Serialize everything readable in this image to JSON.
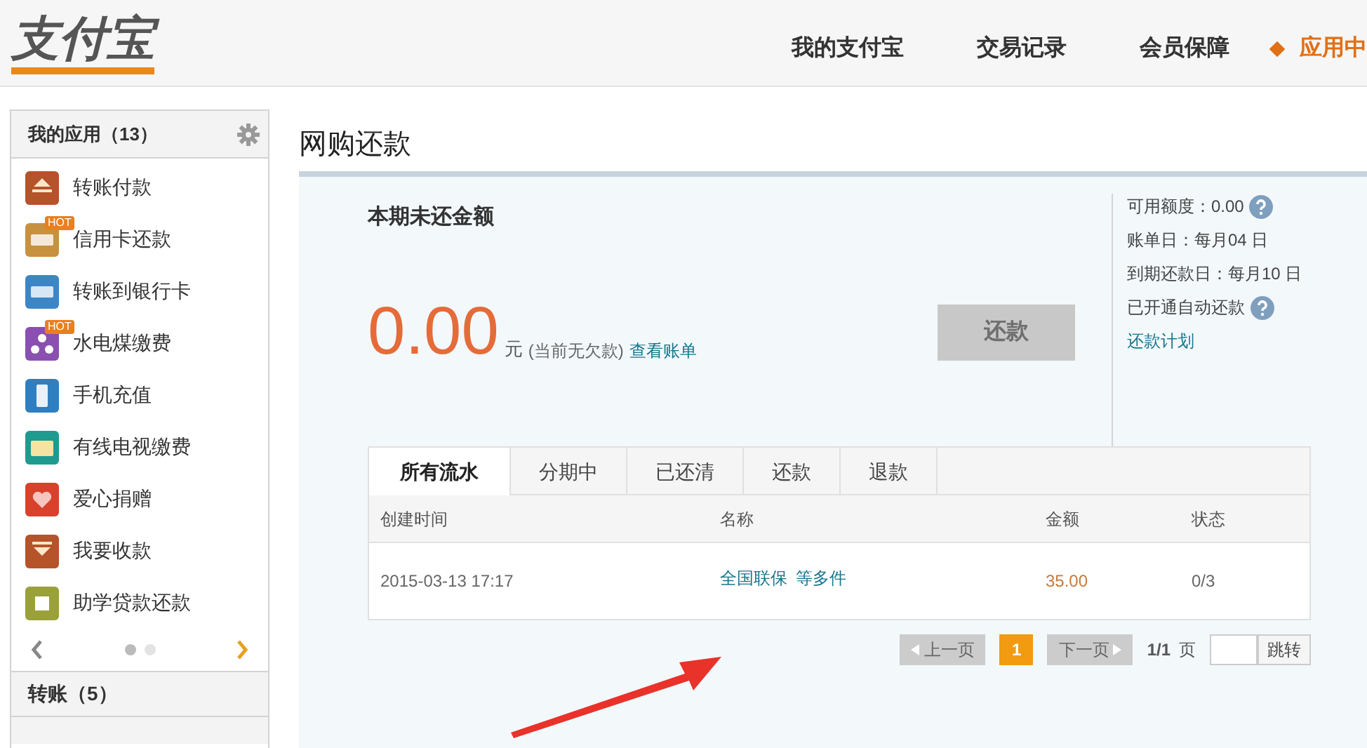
{
  "header": {
    "logo": "支付宝",
    "nav": [
      {
        "label": "我的支付宝",
        "selected": false
      },
      {
        "label": "交易记录",
        "selected": false
      },
      {
        "label": "会员保障",
        "selected": false
      },
      {
        "label": "应用中",
        "selected": true
      }
    ]
  },
  "sidebar": {
    "title": "我的应用（13）",
    "apps": [
      {
        "label": "转账付款",
        "color": "#b5532a",
        "kind": "up"
      },
      {
        "label": "信用卡还款",
        "color": "#c8913f",
        "kind": "card",
        "badge": "HOT"
      },
      {
        "label": "转账到银行卡",
        "color": "#3d86c6",
        "kind": "card"
      },
      {
        "label": "水电煤缴费",
        "color": "#8a4fb0",
        "kind": "dots",
        "badge": "HOT"
      },
      {
        "label": "手机充值",
        "color": "#2f7fc0",
        "kind": "phone"
      },
      {
        "label": "有线电视缴费",
        "color": "#1f9a8f",
        "kind": "tv"
      },
      {
        "label": "爱心捐赠",
        "color": "#d9412b",
        "kind": "heart"
      },
      {
        "label": "我要收款",
        "color": "#b5532a",
        "kind": "down"
      },
      {
        "label": "助学贷款还款",
        "color": "#9aa03a",
        "kind": "square"
      }
    ],
    "pager_dots": [
      {
        "selected": true
      },
      {
        "selected": false
      }
    ],
    "sections": [
      "转账（5）"
    ]
  },
  "page_title": "网购还款",
  "summary": {
    "heading": "本期未还金额",
    "amount": "0.00",
    "unit": "元",
    "note": "(当前无欠款)",
    "link": "查看账单",
    "button": {
      "label": "还款",
      "disabled": true
    },
    "info": [
      {
        "text": "可用额度：0.00",
        "help": true
      },
      {
        "text": "账单日：每月04 日",
        "help": false
      },
      {
        "text": "到期还款日：每月10 日",
        "help": false
      },
      {
        "text": "已开通自动还款",
        "help": true
      }
    ],
    "plan_link": "还款计划"
  },
  "tabs": [
    {
      "label": "所有流水",
      "selected": true
    },
    {
      "label": "分期中",
      "selected": false
    },
    {
      "label": "已还清",
      "selected": false
    },
    {
      "label": "还款",
      "selected": false
    },
    {
      "label": "退款",
      "selected": false
    }
  ],
  "table": {
    "columns": [
      "创建时间",
      "名称",
      "金额",
      "状态"
    ],
    "rows": [
      {
        "time": "2015-03-13 17:17",
        "name": "全国联保",
        "more": "等多件",
        "amount": "35.00",
        "status": "0/3"
      }
    ]
  },
  "pagination": {
    "prev": {
      "label": "上一页",
      "disabled": true
    },
    "pages": [
      {
        "label": "1",
        "selected": true
      }
    ],
    "next": {
      "label": "下一页",
      "disabled": true
    },
    "count": "1/1",
    "unit": "页",
    "jump": "跳转"
  }
}
